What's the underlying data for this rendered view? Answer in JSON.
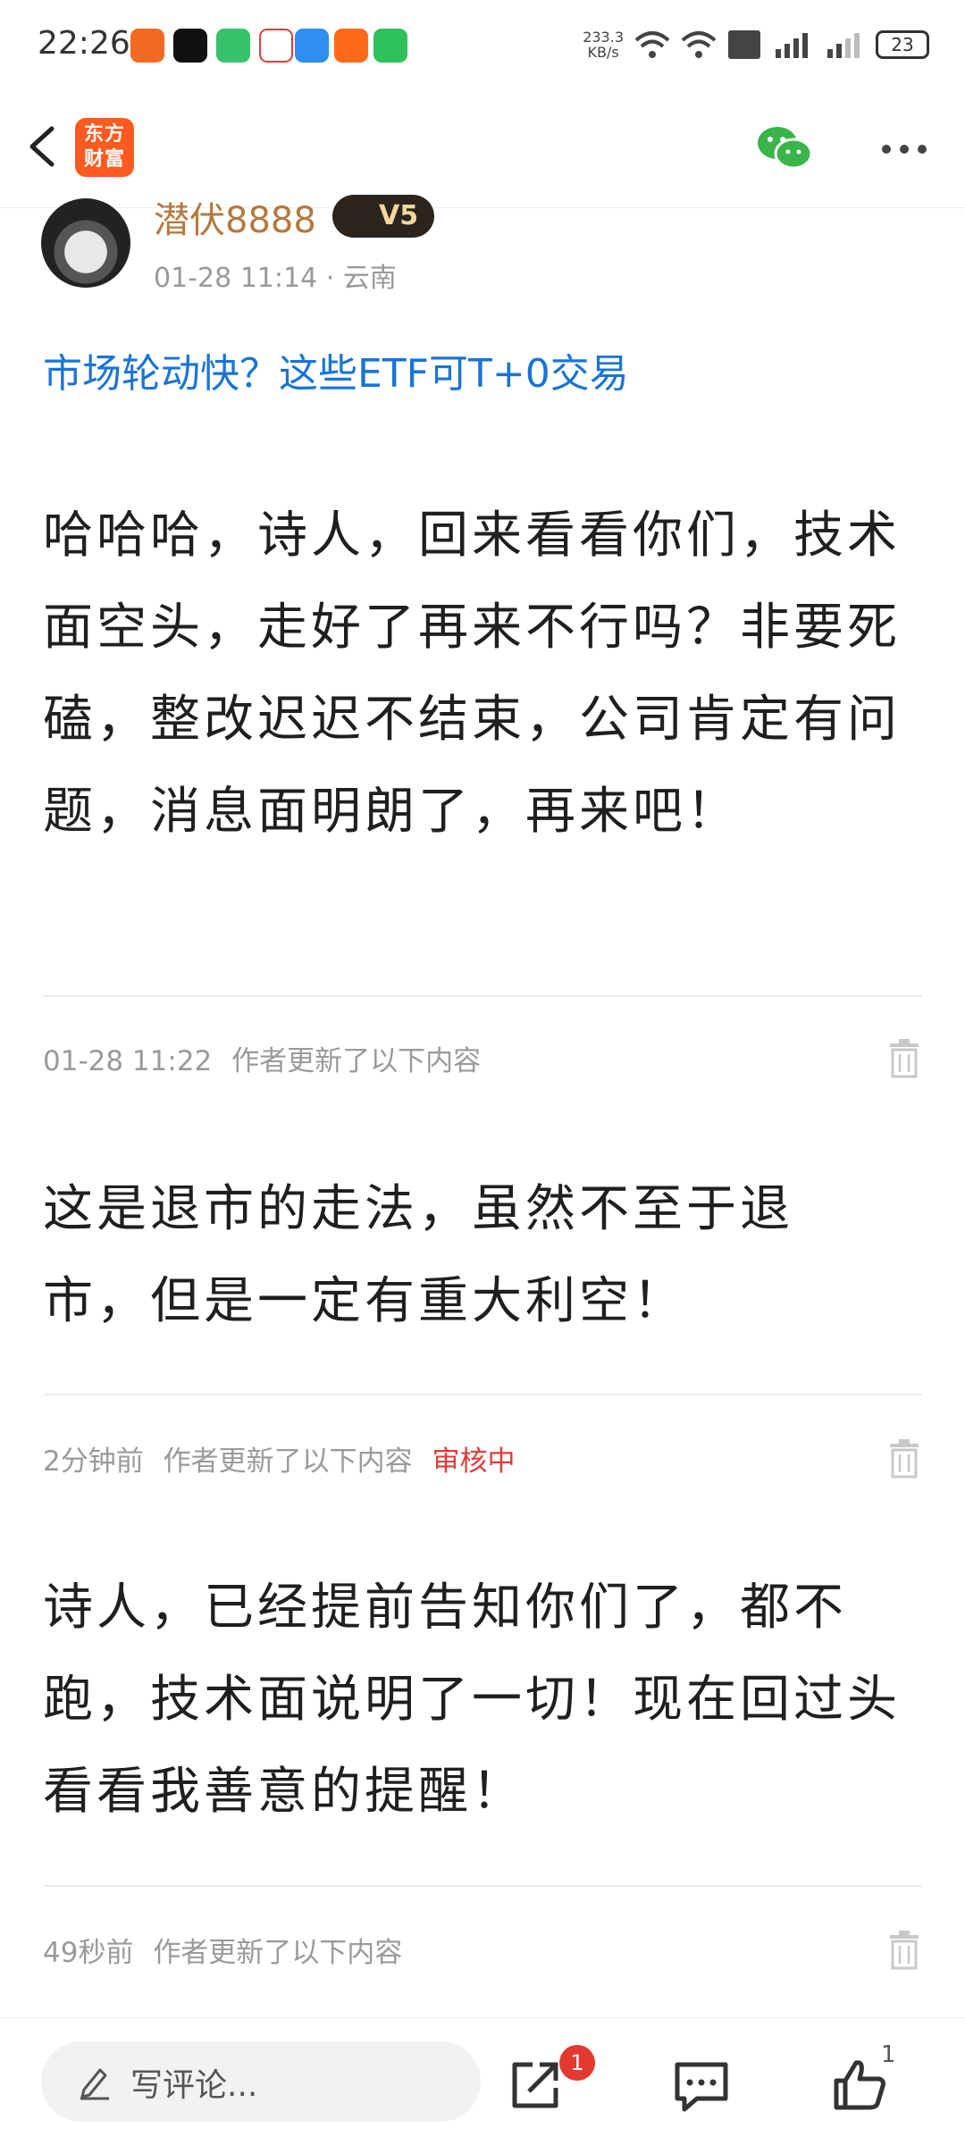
{
  "status_bar": {
    "time": "22:26",
    "net_speed": "233.3",
    "net_unit": "KB/s",
    "battery": "23"
  },
  "header": {
    "logo_line1": "东方",
    "logo_line2": "财富",
    "colors": {
      "logo_bg": "#ff5a1f",
      "wechat_green": "#3bb44a"
    }
  },
  "post": {
    "author": "潜伏8888",
    "level": "V5",
    "meta": "01-28 11:14 · 云南",
    "link_text": "市场轮动快？这些ETF可T+0交易",
    "body": "哈哈哈，诗人，回来看看你们，技术面空头，走好了再来不行吗？非要死磕，整改迟迟不结束，公司肯定有问题，消息面明朗了，再来吧！"
  },
  "updates": [
    {
      "time": "01-28 11:22",
      "label": "作者更新了以下内容",
      "status": "",
      "body": "这是退市的走法，虽然不至于退市，但是一定有重大利空！"
    },
    {
      "time": "2分钟前",
      "label": "作者更新了以下内容",
      "status": "审核中",
      "body": "诗人，已经提前告知你们了，都不跑，技术面说明了一切！现在回过头看看我善意的提醒！"
    },
    {
      "time": "49秒前",
      "label": "作者更新了以下内容",
      "status": ""
    }
  ],
  "bottom_bar": {
    "comment_placeholder": "写评论...",
    "share_badge": "1",
    "like_count": "1"
  }
}
